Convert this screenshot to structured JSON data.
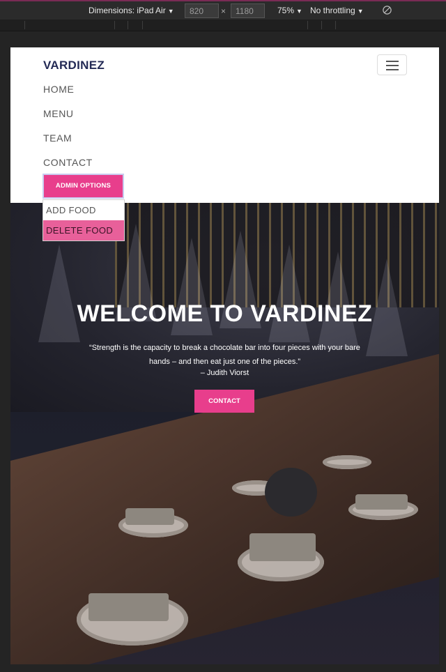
{
  "devtools": {
    "device_label": "Dimensions: iPad Air",
    "width_value": "820",
    "height_value": "1180",
    "times_sign": "×",
    "zoom_label": "75%",
    "throttle_label": "No throttling",
    "caret": "▼",
    "rotate_icon": "rotate-icon"
  },
  "navbar": {
    "brand": "VARDINEZ",
    "toggler_icon": "hamburger-icon",
    "links": [
      "HOME",
      "MENU",
      "TEAM",
      "CONTACT"
    ],
    "admin_button": "ADMIN OPTIONS",
    "dropdown_items": [
      "ADD FOOD",
      "DELETE FOOD"
    ],
    "active_dropdown_item": "DELETE FOOD"
  },
  "hero": {
    "title": "WELCOME TO VARDINEZ",
    "quote": "“Strength is the capacity to break a chocolate bar into four pieces with your bare hands – and then eat just one of the pieces.”",
    "author": "– Judith Viorst",
    "contact_button": "CONTACT"
  },
  "colors": {
    "accent": "#e83e8c",
    "brand_text": "#232a55",
    "active_item": "#e8609a",
    "devtools_bg": "#2b2b2b"
  }
}
